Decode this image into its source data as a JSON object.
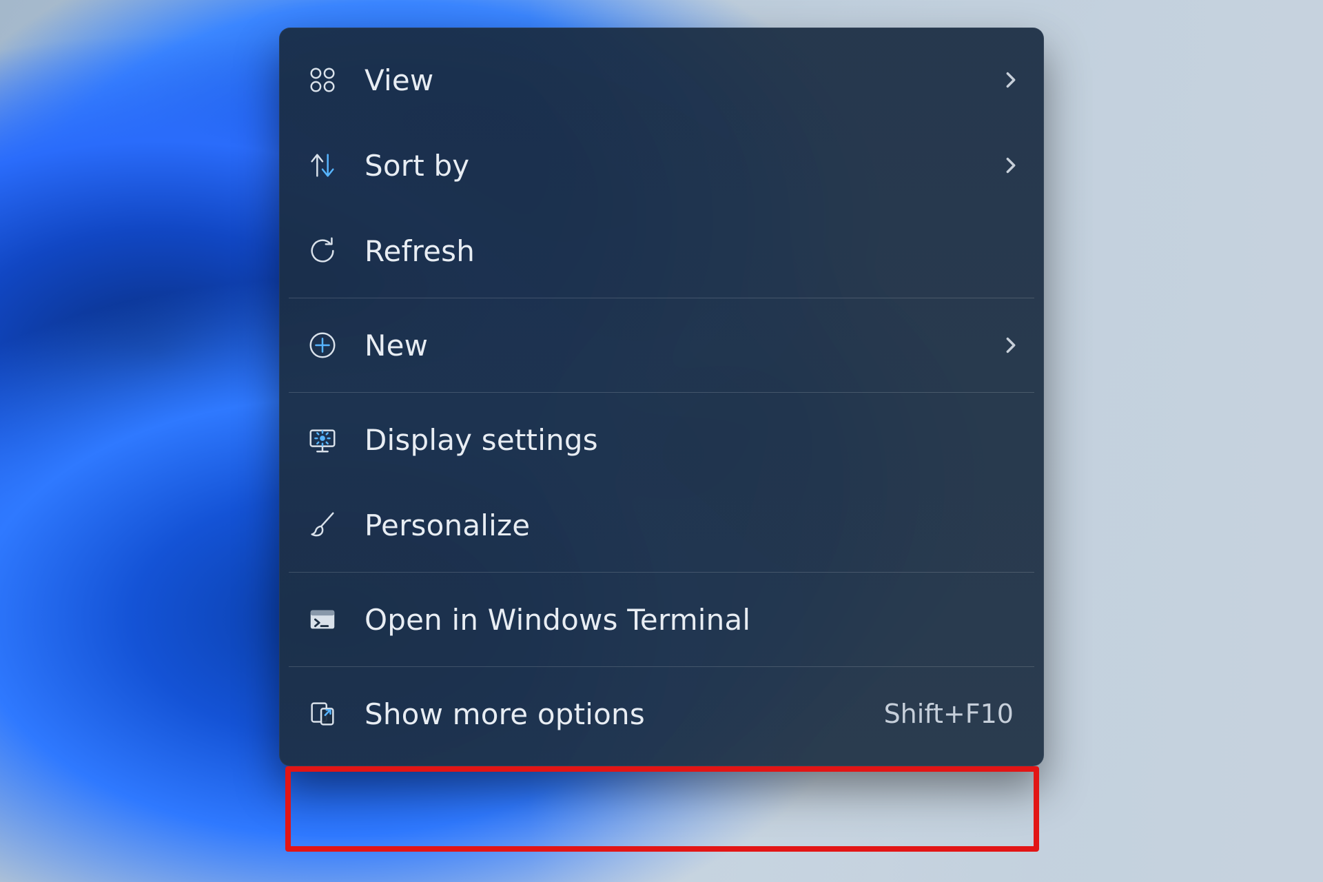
{
  "context_menu": {
    "items": [
      {
        "label": "View",
        "icon": "grid-icon",
        "has_submenu": true,
        "shortcut": ""
      },
      {
        "label": "Sort by",
        "icon": "sort-icon",
        "has_submenu": true,
        "shortcut": ""
      },
      {
        "label": "Refresh",
        "icon": "refresh-icon",
        "has_submenu": false,
        "shortcut": ""
      }
    ],
    "group2": [
      {
        "label": "New",
        "icon": "plus-circle-icon",
        "has_submenu": true,
        "shortcut": ""
      }
    ],
    "group3": [
      {
        "label": "Display settings",
        "icon": "display-settings-icon",
        "has_submenu": false,
        "shortcut": ""
      },
      {
        "label": "Personalize",
        "icon": "paintbrush-icon",
        "has_submenu": false,
        "shortcut": ""
      }
    ],
    "group4": [
      {
        "label": "Open in Windows Terminal",
        "icon": "terminal-icon",
        "has_submenu": false,
        "shortcut": ""
      }
    ],
    "group5": [
      {
        "label": "Show more options",
        "icon": "expand-icon",
        "has_submenu": false,
        "shortcut": "Shift+F10"
      }
    ]
  },
  "annotation": {
    "highlight_target": "menu-item-show-more-options"
  }
}
